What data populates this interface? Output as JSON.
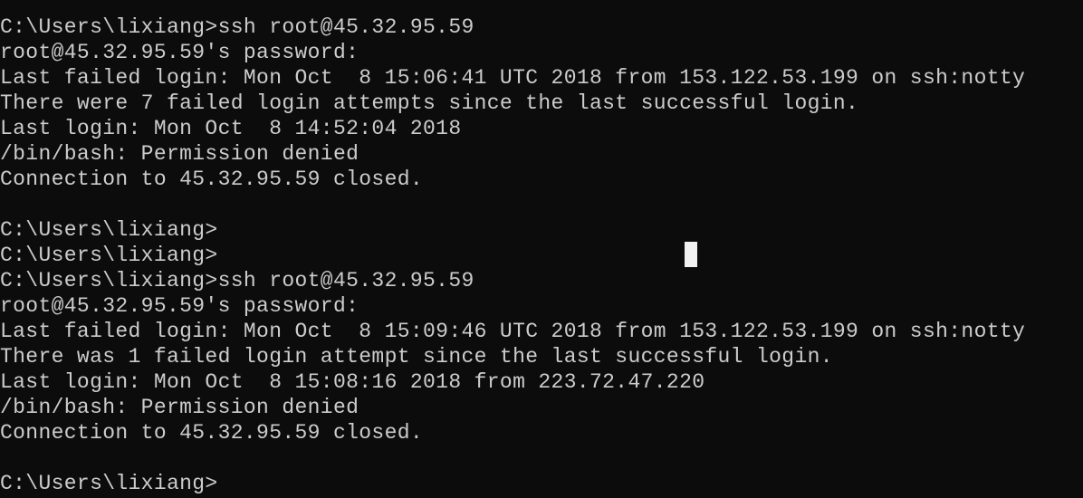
{
  "terminal": {
    "lines": [
      "C:\\Users\\lixiang>ssh root@45.32.95.59",
      "root@45.32.95.59's password:",
      "Last failed login: Mon Oct  8 15:06:41 UTC 2018 from 153.122.53.199 on ssh:notty",
      "There were 7 failed login attempts since the last successful login.",
      "Last login: Mon Oct  8 14:52:04 2018",
      "/bin/bash: Permission denied",
      "Connection to 45.32.95.59 closed.",
      "",
      "C:\\Users\\lixiang>",
      "C:\\Users\\lixiang>",
      "C:\\Users\\lixiang>ssh root@45.32.95.59",
      "root@45.32.95.59's password:",
      "Last failed login: Mon Oct  8 15:09:46 UTC 2018 from 153.122.53.199 on ssh:notty",
      "There was 1 failed login attempt since the last successful login.",
      "Last login: Mon Oct  8 15:08:16 2018 from 223.72.47.220",
      "/bin/bash: Permission denied",
      "Connection to 45.32.95.59 closed.",
      "",
      "C:\\Users\\lixiang>"
    ]
  },
  "colors": {
    "background": "#0c0c0c",
    "foreground": "#cccccc",
    "cursor": "#f2f2f2"
  }
}
